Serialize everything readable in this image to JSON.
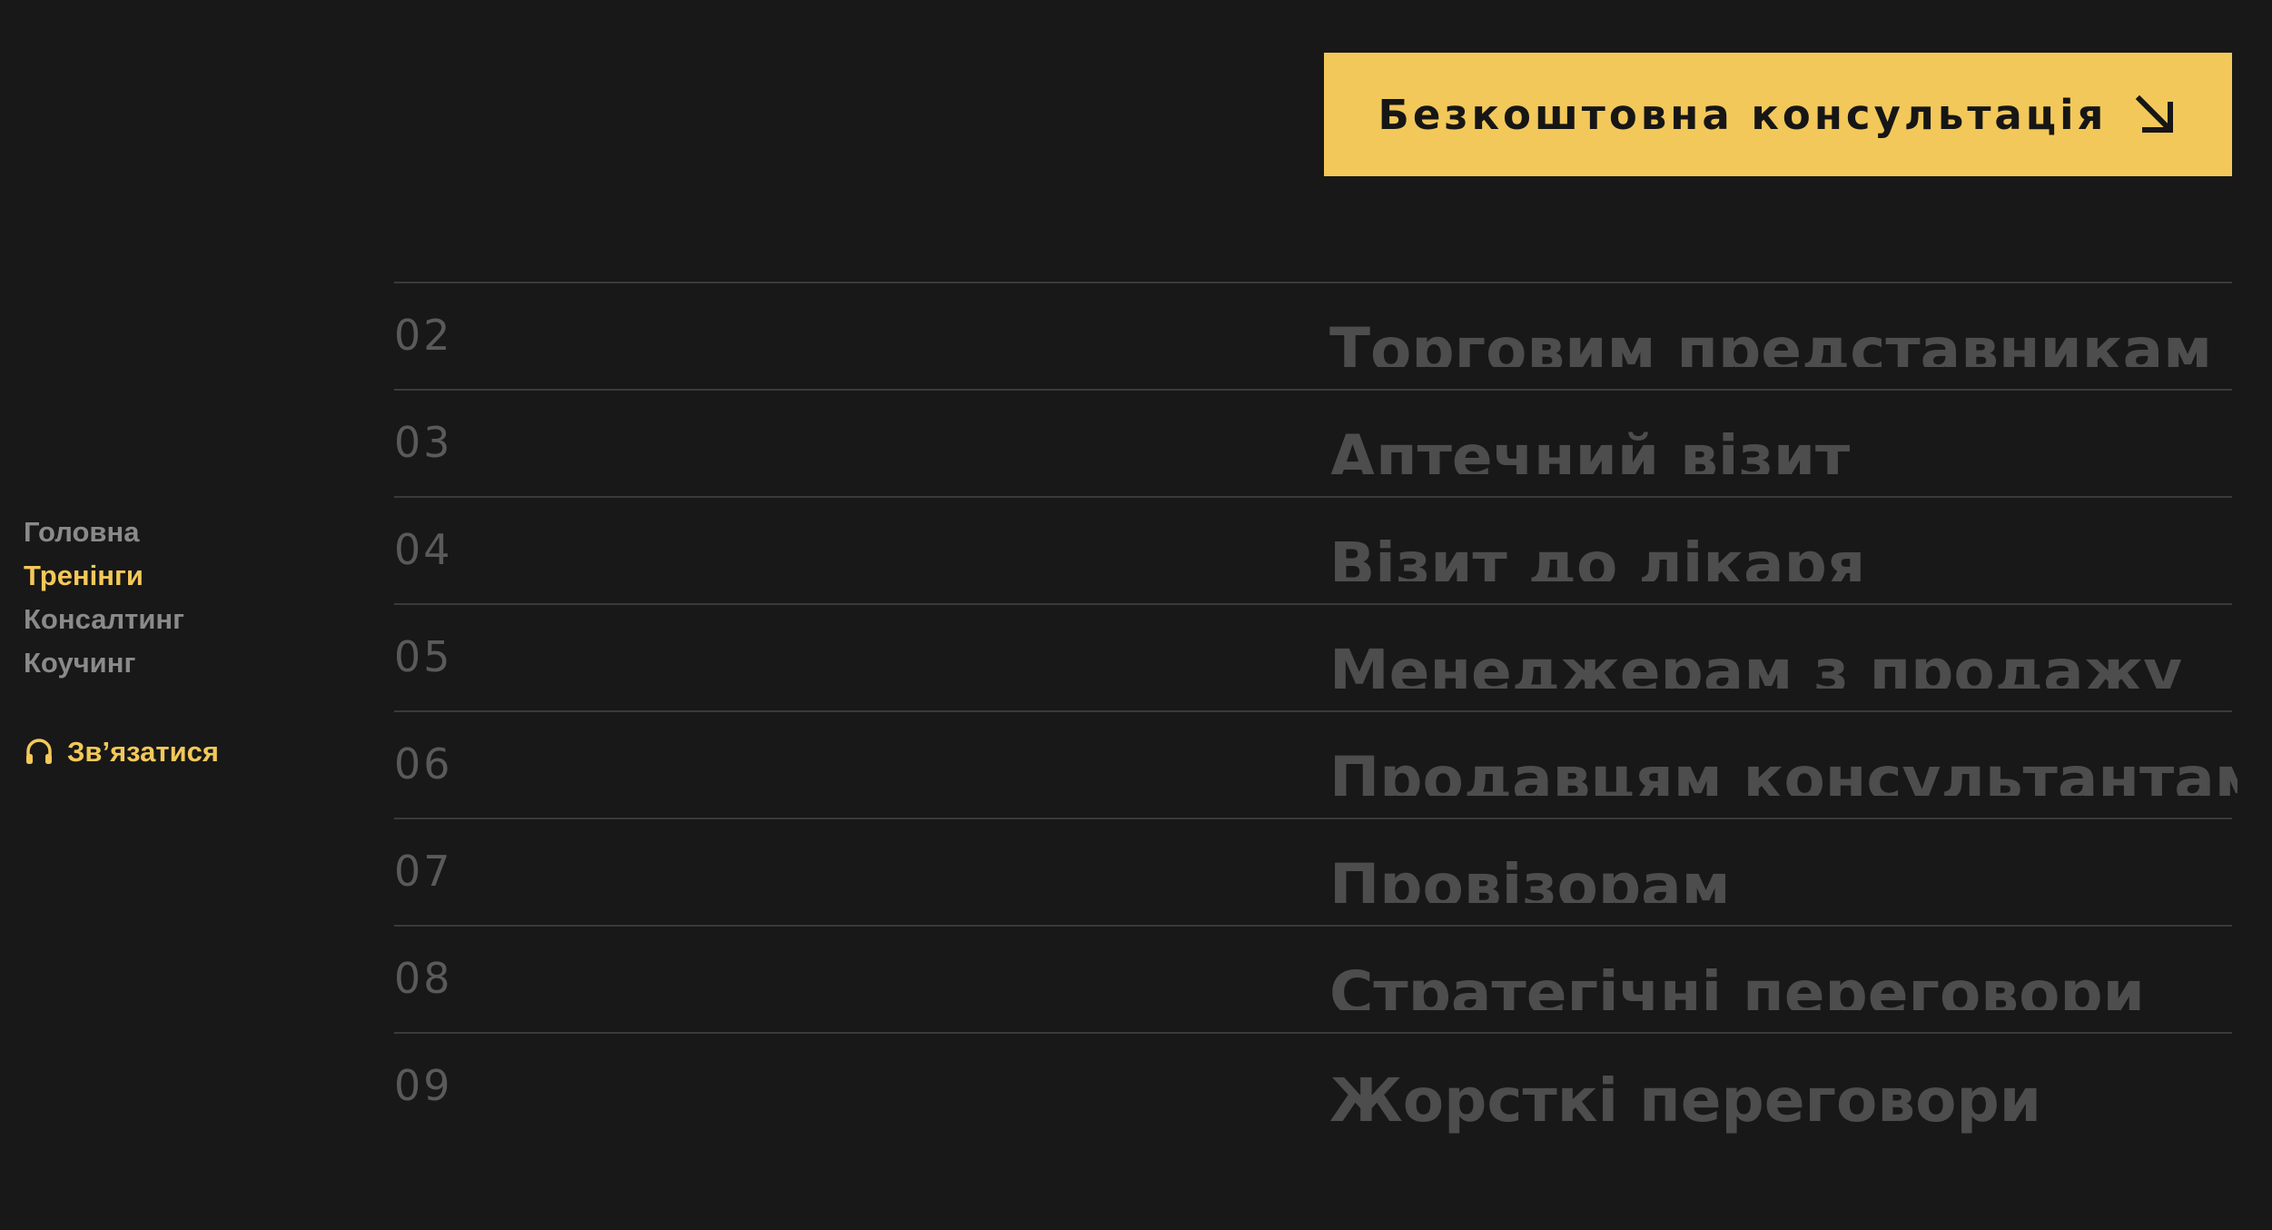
{
  "header": {
    "cta_label": "Безкоштовна консультація",
    "cta_icon": "arrow-down-right-icon"
  },
  "sidebar": {
    "items": [
      {
        "label": "Головна",
        "active": false
      },
      {
        "label": "Тренінги",
        "active": true
      },
      {
        "label": "Консалтинг",
        "active": false
      },
      {
        "label": "Коучинг",
        "active": false
      }
    ],
    "contact": {
      "icon": "headset-icon",
      "label": "Зв’язатися"
    }
  },
  "trainings": [
    {
      "number": "02",
      "title": "Торговим представникам"
    },
    {
      "number": "03",
      "title": "Аптечний візит"
    },
    {
      "number": "04",
      "title": "Візит до лікаря"
    },
    {
      "number": "05",
      "title": "Менеджерам з продажу"
    },
    {
      "number": "06",
      "title": "Продавцям консультантам"
    },
    {
      "number": "07",
      "title": "Провізорам"
    },
    {
      "number": "08",
      "title": "Стратегічні переговори"
    },
    {
      "number": "09",
      "title": "Жорсткі переговори"
    }
  ],
  "colors": {
    "background": "#181818",
    "accent": "#f3c85a",
    "nav_inactive": "#8a8a8a",
    "row_text": "#4d4d4d",
    "divider": "#3a3a3a"
  }
}
